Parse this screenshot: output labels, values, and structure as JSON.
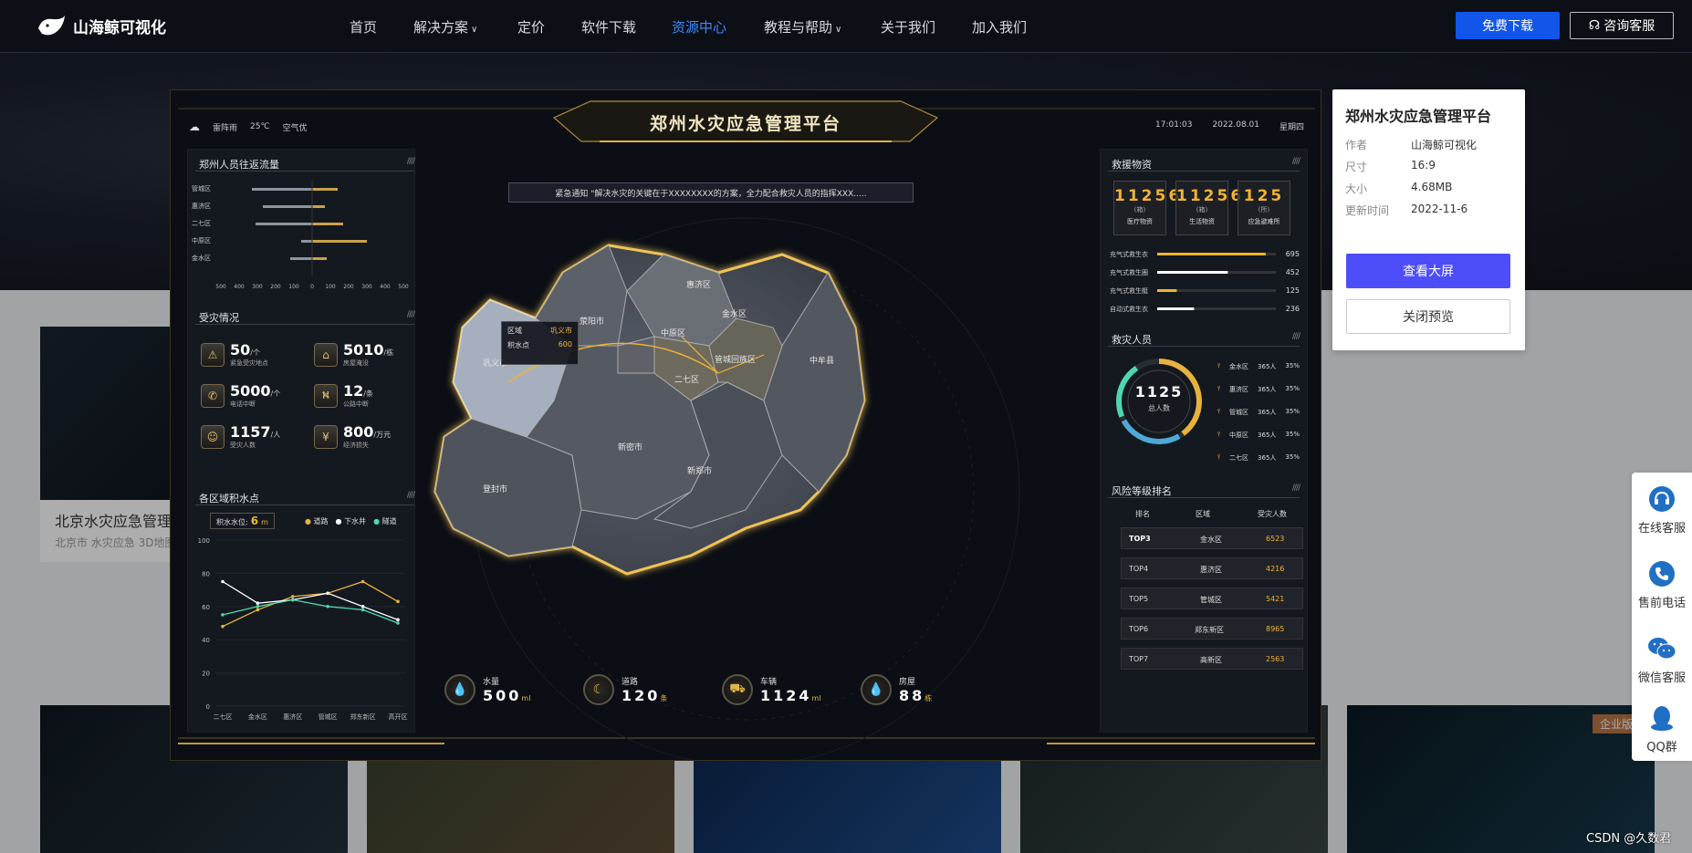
{
  "nav": {
    "logo_text": "山海鲸可视化",
    "items": [
      {
        "label": "首页",
        "dropdown": false
      },
      {
        "label": "解决方案",
        "dropdown": true
      },
      {
        "label": "定价",
        "dropdown": false
      },
      {
        "label": "软件下载",
        "dropdown": false
      },
      {
        "label": "资源中心",
        "dropdown": false,
        "active": true
      },
      {
        "label": "教程与帮助",
        "dropdown": true
      },
      {
        "label": "关于我们",
        "dropdown": false
      },
      {
        "label": "加入我们",
        "dropdown": false
      }
    ],
    "free_download": "免费下载",
    "consult": "咨询客服"
  },
  "background_card": {
    "title": "北京水灾应急管理",
    "tags": "北京市 水灾应急 3D地图"
  },
  "preview": {
    "title": "郑州水灾应急管理平台",
    "weather": [
      "雷阵雨",
      "25℃",
      "空气优"
    ],
    "time": "17:01:03",
    "date": "2022.08.01",
    "weekday": "星期四",
    "notice": "紧急通知 \"解决水灾的关键在于XXXXXXXX的方案，全力配合救灾人员的指挥XXX.....",
    "flow": {
      "title": "郑州人员往返流量",
      "rows": [
        "管城区",
        "惠济区",
        "二七区",
        "中原区",
        "金水区"
      ],
      "axis": [
        "500",
        "400",
        "300",
        "200",
        "100",
        "0",
        "100",
        "200",
        "300",
        "400",
        "500"
      ]
    },
    "disaster": {
      "title": "受灾情况",
      "items": [
        {
          "value": "50",
          "unit": "/个",
          "label": "紧急受灾地点"
        },
        {
          "value": "5010",
          "unit": "/栋",
          "label": "房屋淹没"
        },
        {
          "value": "5000",
          "unit": "/个",
          "label": "电话中断"
        },
        {
          "value": "12",
          "unit": "/条",
          "label": "公路中断"
        },
        {
          "value": "1157",
          "unit": "/人",
          "label": "受灾人数"
        },
        {
          "value": "800",
          "unit": "/万元",
          "label": "经济损失"
        }
      ]
    },
    "water": {
      "title": "各区域积水点",
      "level_label": "积水水位:",
      "level_value": "6",
      "level_unit": "m",
      "legend": [
        "道路",
        "下水井",
        "隧道"
      ]
    },
    "map": {
      "labels": [
        "惠济区",
        "金水区",
        "中原区",
        "管城回族区",
        "二七区",
        "巩义市",
        "荥阳市",
        "中牟县",
        "新密市",
        "新郑市",
        "登封市"
      ],
      "tooltip": {
        "k1": "区域",
        "v1": "巩义市",
        "k2": "积水点",
        "v2": "600"
      }
    },
    "bottom_stats": [
      {
        "label": "水量",
        "value": "500",
        "unit": "ml",
        "icon": "water-drop"
      },
      {
        "label": "道路",
        "value": "120",
        "unit": "条",
        "icon": "moon"
      },
      {
        "label": "车辆",
        "value": "1124",
        "unit": "ml",
        "icon": "car"
      },
      {
        "label": "房屋",
        "value": "88",
        "unit": "栋",
        "icon": "water-drop"
      }
    ],
    "supplies": {
      "title": "救援物资",
      "items": [
        {
          "value": "11256",
          "unit": "(箱)",
          "label": "医疗物资"
        },
        {
          "value": "11256",
          "unit": "(箱)",
          "label": "生活物资"
        },
        {
          "value": "125",
          "unit": "(所)",
          "label": "应急避难所"
        }
      ],
      "tents": [
        {
          "label": "充气式救生衣",
          "value": "695"
        },
        {
          "label": "充气式救生圈",
          "value": "452"
        },
        {
          "label": "充气式救生艇",
          "value": "125"
        },
        {
          "label": "自动式救生衣",
          "value": "236"
        }
      ]
    },
    "rescuers": {
      "title": "救灾人员",
      "total": "1125",
      "total_label": "总人数",
      "rows": [
        {
          "area": "金水区",
          "count": "365人",
          "pct": "35%"
        },
        {
          "area": "惠济区",
          "count": "365人",
          "pct": "35%"
        },
        {
          "area": "管城区",
          "count": "365人",
          "pct": "35%"
        },
        {
          "area": "中原区",
          "count": "365人",
          "pct": "35%"
        },
        {
          "area": "二七区",
          "count": "365人",
          "pct": "35%"
        }
      ]
    },
    "risk": {
      "title": "风险等级排名",
      "headers": [
        "排名",
        "区域",
        "受灾人数"
      ],
      "rows": [
        {
          "rank": "TOP3",
          "area": "金水区",
          "value": "6523"
        },
        {
          "rank": "TOP4",
          "area": "惠济区",
          "value": "4216"
        },
        {
          "rank": "TOP5",
          "area": "管城区",
          "value": "5421"
        },
        {
          "rank": "TOP6",
          "area": "郑东新区",
          "value": "8965"
        },
        {
          "rank": "TOP7",
          "area": "高新区",
          "value": "2563"
        }
      ]
    }
  },
  "chart_data": [
    {
      "type": "bar",
      "title": "郑州人员往返流量",
      "categories": [
        "管城区",
        "惠济区",
        "二七区",
        "中原区",
        "金水区"
      ],
      "series": [
        {
          "values": [
            -330,
            -270,
            -310,
            -60,
            -120
          ]
        },
        {
          "values": [
            140,
            70,
            170,
            300,
            80
          ]
        }
      ],
      "xlim": [
        -500,
        500
      ]
    },
    {
      "type": "line",
      "title": "各区域积水点",
      "categories": [
        "二七区",
        "金水区",
        "惠济区",
        "管城区",
        "郑东新区",
        "高开区"
      ],
      "series": [
        {
          "name": "道路",
          "values": [
            48,
            58,
            66,
            68,
            75,
            63
          ]
        },
        {
          "name": "下水井",
          "values": [
            75,
            62,
            64,
            68,
            60,
            52
          ]
        },
        {
          "name": "隧道",
          "values": [
            55,
            60,
            64,
            60,
            58,
            50
          ]
        }
      ],
      "ylim": [
        0,
        100
      ],
      "yticks": [
        0,
        20,
        40,
        60,
        80,
        100
      ]
    }
  ],
  "info_card": {
    "title": "郑州水灾应急管理平台",
    "fields": [
      {
        "k": "作者",
        "v": "山海鲸可视化"
      },
      {
        "k": "尺寸",
        "v": "16:9"
      },
      {
        "k": "大小",
        "v": "4.68MB"
      },
      {
        "k": "更新时间",
        "v": "2022-11-6"
      }
    ],
    "view_button": "查看大屏",
    "close_button": "关闭预览"
  },
  "sidebar": [
    {
      "label": "在线客服",
      "icon": "headset-icon"
    },
    {
      "label": "售前电话",
      "icon": "phone-icon"
    },
    {
      "label": "微信客服",
      "icon": "wechat-icon"
    },
    {
      "label": "QQ群",
      "icon": "qq-icon"
    }
  ],
  "thumb_badge": "企业版",
  "watermark": "CSDN @久数君",
  "colors": {
    "accent": "#1156e8",
    "active_nav": "#3d8bff",
    "gold": "#f2b233",
    "primary_button": "#4d4dfa"
  }
}
